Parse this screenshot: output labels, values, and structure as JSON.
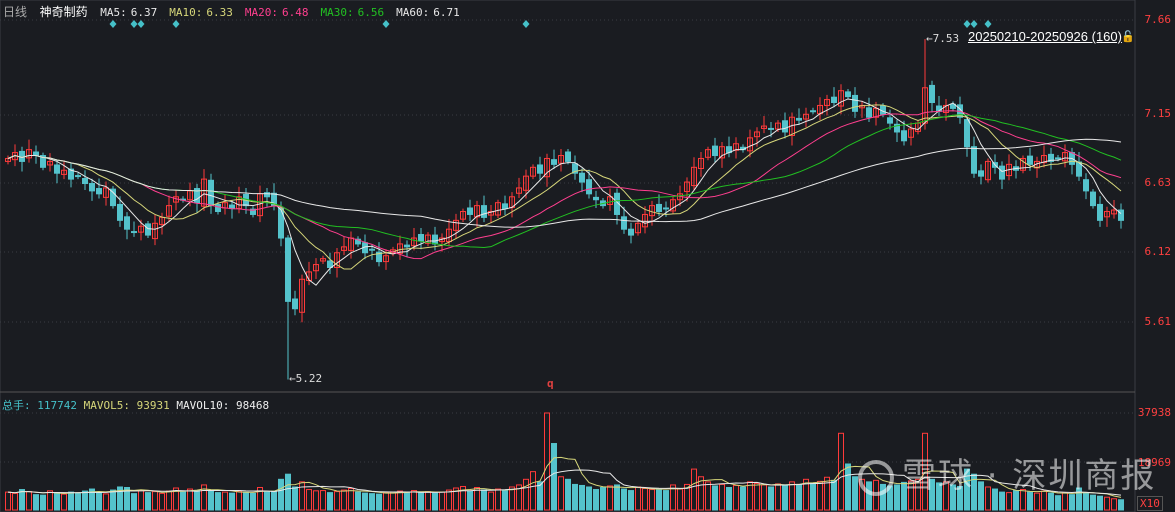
{
  "header": {
    "period": "日线",
    "stock_name": "神奇制药",
    "ma": [
      {
        "label": "MA5:",
        "value": "6.37",
        "color": "#e8e8e8"
      },
      {
        "label": "MA10:",
        "value": "6.33",
        "color": "#d6d67a"
      },
      {
        "label": "MA20:",
        "value": "6.48",
        "color": "#ff3f8f"
      },
      {
        "label": "MA30:",
        "value": "6.56",
        "color": "#22c022"
      },
      {
        "label": "MA60:",
        "value": "6.71",
        "color": "#e8e8e8"
      }
    ]
  },
  "volume_header": {
    "total_label": "总手:",
    "total_value": "117742",
    "mavol5_label": "MAVOL5:",
    "mavol5_value": "93931",
    "mavol10_label": "MAVOL10:",
    "mavol10_value": "98468"
  },
  "range_label": "20250210-20250926 (160)",
  "lock_icon": "lock-icon",
  "watermark": "雪球 · 深圳商报",
  "marker_q": "q",
  "colors": {
    "up": "#ff3a3a",
    "down": "#54c3cc",
    "background": "#1a1c21",
    "grid": "#3a3d44"
  },
  "chart_data": {
    "type": "candlestick",
    "title": "神奇制药 日线",
    "price_axis": {
      "ticks": [
        "7.66",
        "7.15",
        "6.63",
        "6.12",
        "5.61"
      ],
      "ylim": [
        5.61,
        7.66
      ]
    },
    "volume_axis": {
      "ticks": [
        "37938",
        "18969"
      ],
      "unit_label": "X10",
      "ylim": [
        0,
        37938
      ]
    },
    "annotations": {
      "high": {
        "bar": 131,
        "value": "7.53"
      },
      "low": {
        "bar": 40,
        "value": "5.22"
      }
    },
    "event_markers": [
      15,
      18,
      19,
      24,
      54,
      74,
      137,
      138,
      140
    ],
    "close": [
      6.72,
      6.76,
      6.7,
      6.78,
      6.74,
      6.66,
      6.7,
      6.62,
      6.64,
      6.58,
      6.6,
      6.55,
      6.5,
      6.48,
      6.52,
      6.4,
      6.3,
      6.24,
      6.22,
      6.26,
      6.2,
      6.28,
      6.32,
      6.4,
      6.46,
      6.44,
      6.5,
      6.42,
      6.58,
      6.4,
      6.36,
      6.42,
      6.38,
      6.46,
      6.4,
      6.34,
      6.48,
      6.46,
      6.4,
      6.18,
      5.75,
      5.7,
      5.9,
      5.95,
      6.0,
      6.04,
      5.98,
      6.08,
      6.12,
      6.18,
      6.14,
      6.08,
      6.1,
      6.02,
      6.06,
      6.1,
      6.14,
      6.12,
      6.18,
      6.16,
      6.2,
      6.14,
      6.18,
      6.24,
      6.3,
      6.36,
      6.34,
      6.4,
      6.32,
      6.36,
      6.42,
      6.38,
      6.46,
      6.52,
      6.6,
      6.66,
      6.62,
      6.72,
      6.68,
      6.74,
      6.7,
      6.62,
      6.56,
      6.48,
      6.44,
      6.4,
      6.46,
      6.34,
      6.24,
      6.2,
      6.28,
      6.34,
      6.4,
      6.36,
      6.38,
      6.44,
      6.48,
      6.56,
      6.66,
      6.72,
      6.78,
      6.74,
      6.8,
      6.76,
      6.82,
      6.78,
      6.86,
      6.9,
      6.94,
      6.92,
      6.96,
      6.9,
      7.0,
      6.98,
      7.02,
      7.04,
      7.08,
      7.12,
      7.1,
      7.18,
      7.14,
      7.04,
      7.08,
      7.0,
      7.06,
      7.02,
      6.96,
      6.9,
      6.84,
      6.92,
      6.96,
      7.2,
      7.1,
      7.04,
      7.08,
      7.06,
      7.0,
      6.8,
      6.62,
      6.6,
      6.7,
      6.66,
      6.58,
      6.68,
      6.64,
      6.72,
      6.68,
      6.7,
      6.74,
      6.7,
      6.72,
      6.76,
      6.68,
      6.6,
      6.5,
      6.4,
      6.3,
      6.36,
      6.37,
      6.3
    ],
    "volume": [
      7000,
      6500,
      8000,
      7200,
      6000,
      5800,
      7500,
      6800,
      6200,
      7000,
      6600,
      7400,
      8200,
      6900,
      6300,
      7800,
      9000,
      8800,
      6400,
      7600,
      6800,
      7200,
      6500,
      7400,
      8600,
      7000,
      8200,
      7600,
      9800,
      7300,
      6800,
      7000,
      6600,
      7400,
      6900,
      6500,
      8800,
      7200,
      7400,
      12000,
      14000,
      9000,
      11000,
      8000,
      7500,
      7600,
      6800,
      7200,
      7800,
      8400,
      7000,
      6600,
      6400,
      6200,
      6800,
      7000,
      7400,
      6800,
      7600,
      6900,
      7200,
      6600,
      7000,
      7800,
      8600,
      9200,
      7400,
      8800,
      7800,
      7000,
      8200,
      7600,
      9000,
      9800,
      12000,
      15000,
      11000,
      37938,
      26000,
      13000,
      12000,
      10000,
      9600,
      9000,
      8000,
      8800,
      9400,
      9800,
      8200,
      7600,
      9000,
      8400,
      8000,
      7800,
      7600,
      9800,
      8200,
      10000,
      16000,
      13000,
      11000,
      9400,
      10000,
      8800,
      9600,
      9000,
      11000,
      10400,
      9800,
      9000,
      10200,
      9800,
      11000,
      10000,
      12000,
      10400,
      11200,
      12800,
      11600,
      30000,
      18000,
      13000,
      12000,
      11000,
      11600,
      10000,
      9400,
      9800,
      10800,
      11400,
      12000,
      30000,
      12000,
      10600,
      11000,
      9800,
      9200,
      16000,
      14000,
      11000,
      9000,
      8200,
      7000,
      6800,
      7600,
      8000,
      7000,
      6600,
      7400,
      6600,
      5600,
      6800,
      6000,
      8600,
      6800,
      5800,
      5400,
      5000,
      4400,
      4000
    ]
  }
}
